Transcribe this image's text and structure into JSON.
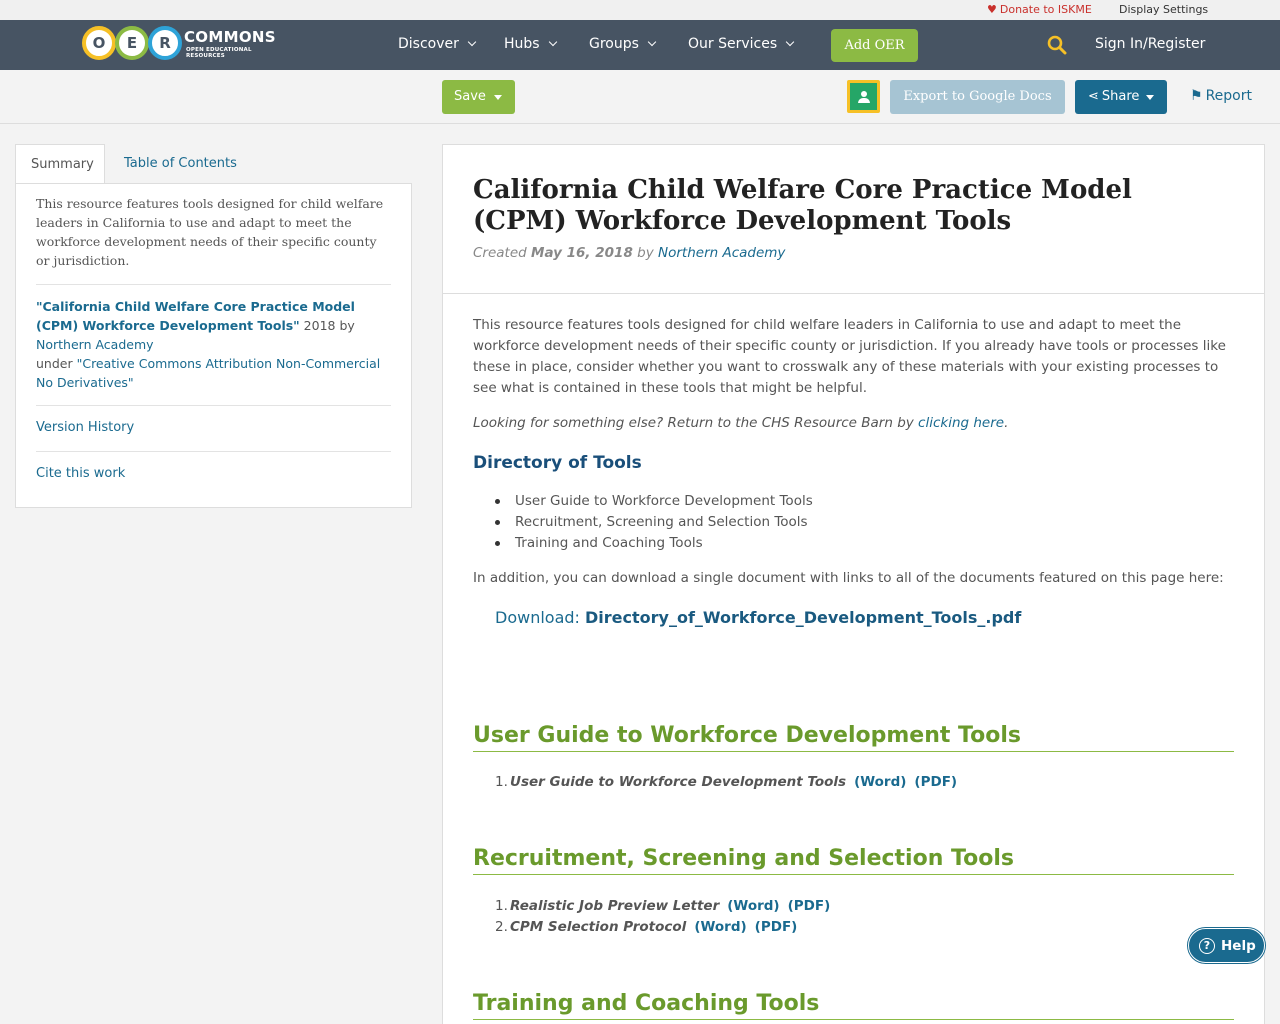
{
  "utility": {
    "donate": "Donate to ISKME",
    "display_settings": "Display Settings"
  },
  "nav": {
    "logo_letters": [
      "O",
      "E",
      "R"
    ],
    "logo_word": "COMMONS",
    "logo_sub": "OPEN EDUCATIONAL RESOURCES",
    "items": [
      "Discover",
      "Hubs",
      "Groups",
      "Our Services"
    ],
    "add_oer": "Add OER",
    "sign_in": "Sign In/Register"
  },
  "toolbar": {
    "save": "Save",
    "export": "Export to Google Docs",
    "share": "Share",
    "report": "Report"
  },
  "sidebar": {
    "tabs": [
      "Summary",
      "Table of Contents"
    ],
    "summary": "This resource features tools designed for child welfare leaders in California to use and adapt to meet the workforce development needs of their specific county or jurisdiction.",
    "attrib_title": "\"California Child Welfare Core Practice Model (CPM) Workforce Development Tools\"",
    "attrib_year_by": " 2018 by ",
    "attrib_author": "Northern Academy",
    "attrib_under": "under ",
    "attrib_license": "\"Creative Commons Attribution Non-Commercial No Derivatives\"",
    "version_history": "Version History",
    "cite": "Cite this work"
  },
  "resource": {
    "title": "California Child Welfare Core Practice Model (CPM) Workforce Development Tools",
    "created_label": "Created ",
    "created_date": "May 16, 2018",
    "by_label": " by ",
    "author": "Northern Academy",
    "intro": "This resource features tools designed for child welfare leaders in California to use and adapt to meet the workforce development needs of their specific county or jurisdiction. If you already have tools or processes like these in place, consider whether you want to crosswalk any of these materials with your existing processes to see what is contained in these tools that might be helpful.",
    "looking_pre": "Looking for something else? Return to the CHS Resource Barn by ",
    "looking_link": "clicking here",
    "looking_post": ".",
    "directory_heading": "Directory of Tools",
    "directory_items": [
      "User Guide to Workforce Development Tools",
      "Recruitment, Screening and Selection Tools",
      "Training and Coaching Tools"
    ],
    "addition": "In addition, you can download a single document with links to all of the documents featured on this page here:",
    "download_label": "Download: ",
    "download_file": "Directory_of_Workforce_Development_Tools_.pdf",
    "sections": [
      {
        "heading": "User Guide to Workforce Development Tools",
        "items": [
          {
            "num": "1.",
            "title": "User Guide to Workforce Development Tools",
            "word": "(Word)",
            "pdf": "(PDF)"
          }
        ]
      },
      {
        "heading": "Recruitment, Screening and Selection Tools",
        "items": [
          {
            "num": "1.",
            "title": "Realistic Job Preview Letter",
            "word": "(Word)",
            "pdf": "(PDF)"
          },
          {
            "num": "2.",
            "title": "CPM Selection Protocol",
            "word": "(Word)",
            "pdf": "(PDF)"
          }
        ]
      },
      {
        "heading": "Training and Coaching Tools",
        "items": []
      }
    ]
  },
  "help": {
    "label": "Help"
  },
  "colors": {
    "nav_bg": "#475463",
    "green": "#8cba44",
    "link": "#1a6a8f",
    "section_green": "#6a9a2c"
  }
}
